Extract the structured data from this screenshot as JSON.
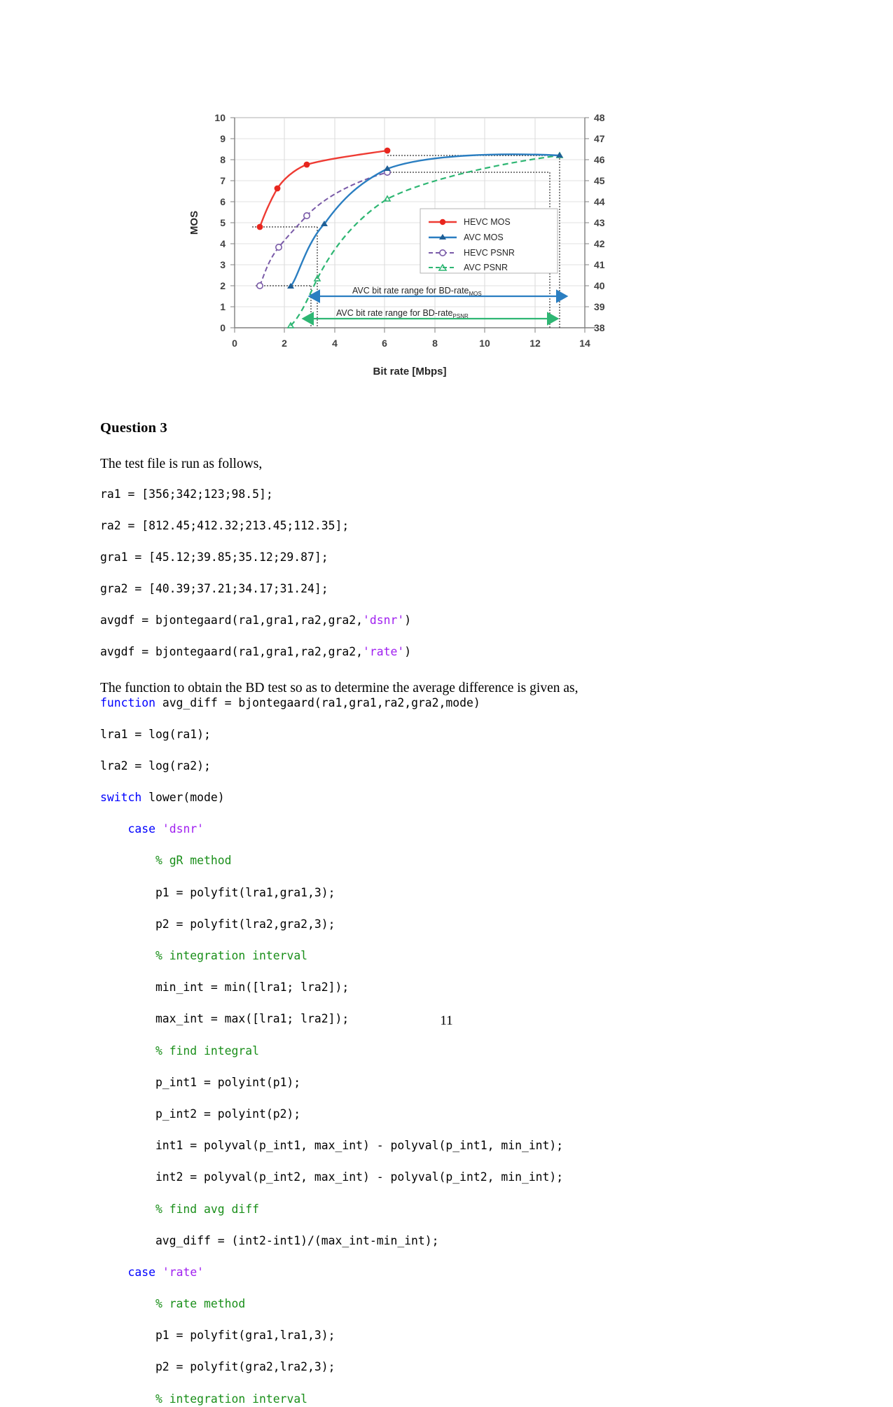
{
  "document": {
    "page_number": "11",
    "question_heading": "Question 3",
    "intro_paragraph": "The test file is run as follows,",
    "function_paragraph": "The function to obtain the BD test so as to determine the average difference is given as,"
  },
  "code_block_1": [
    [
      {
        "t": "ra1 = [356;342;123;98.5];",
        "c": "plain"
      }
    ],
    [
      {
        "t": "ra2 = [812.45;412.32;213.45;112.35];",
        "c": "plain"
      }
    ],
    [
      {
        "t": "gra1 = [45.12;39.85;35.12;29.87];",
        "c": "plain"
      }
    ],
    [
      {
        "t": "gra2 = [40.39;37.21;34.17;31.24];",
        "c": "plain"
      }
    ],
    [
      {
        "t": "avgdf = bjontegaard(ra1,gra1,ra2,gra2,",
        "c": "plain"
      },
      {
        "t": "'dsnr'",
        "c": "str"
      },
      {
        "t": ")",
        "c": "plain"
      }
    ],
    [
      {
        "t": "avgdf = bjontegaard(ra1,gra1,ra2,gra2,",
        "c": "plain"
      },
      {
        "t": "'rate'",
        "c": "str"
      },
      {
        "t": ")",
        "c": "plain"
      }
    ]
  ],
  "code_block_2": [
    [
      {
        "t": "function",
        "c": "kw"
      },
      {
        "t": " avg_diff = bjontegaard(ra1,gra1,ra2,gra2,mode)",
        "c": "plain"
      }
    ],
    [
      {
        "t": "lra1 = log(ra1);",
        "c": "plain"
      }
    ],
    [
      {
        "t": "lra2 = log(ra2);",
        "c": "plain"
      }
    ],
    [
      {
        "t": "switch",
        "c": "kw"
      },
      {
        "t": " lower(mode)",
        "c": "plain"
      }
    ],
    [
      {
        "t": "    ",
        "c": "plain"
      },
      {
        "t": "case",
        "c": "kw"
      },
      {
        "t": " ",
        "c": "plain"
      },
      {
        "t": "'dsnr'",
        "c": "str"
      }
    ],
    [
      {
        "t": "        ",
        "c": "plain"
      },
      {
        "t": "% gR method",
        "c": "cmt"
      }
    ],
    [
      {
        "t": "        p1 = polyfit(lra1,gra1,3);",
        "c": "plain"
      }
    ],
    [
      {
        "t": "        p2 = polyfit(lra2,gra2,3);",
        "c": "plain"
      }
    ],
    [
      {
        "t": "        ",
        "c": "plain"
      },
      {
        "t": "% integration interval",
        "c": "cmt"
      }
    ],
    [
      {
        "t": "        min_int = min([lra1; lra2]);",
        "c": "plain"
      }
    ],
    [
      {
        "t": "        max_int = max([lra1; lra2]);",
        "c": "plain"
      }
    ],
    [
      {
        "t": "        ",
        "c": "plain"
      },
      {
        "t": "% find integral",
        "c": "cmt"
      }
    ],
    [
      {
        "t": "        p_int1 = polyint(p1);",
        "c": "plain"
      }
    ],
    [
      {
        "t": "        p_int2 = polyint(p2);",
        "c": "plain"
      }
    ],
    [
      {
        "t": "        int1 = polyval(p_int1, max_int) - polyval(p_int1, min_int);",
        "c": "plain"
      }
    ],
    [
      {
        "t": "        int2 = polyval(p_int2, max_int) - polyval(p_int2, min_int);",
        "c": "plain"
      }
    ],
    [
      {
        "t": "        ",
        "c": "plain"
      },
      {
        "t": "% find avg diff",
        "c": "cmt"
      }
    ],
    [
      {
        "t": "        avg_diff = (int2-int1)/(max_int-min_int);",
        "c": "plain"
      }
    ],
    [
      {
        "t": "    ",
        "c": "plain"
      },
      {
        "t": "case",
        "c": "kw"
      },
      {
        "t": " ",
        "c": "plain"
      },
      {
        "t": "'rate'",
        "c": "str"
      }
    ],
    [
      {
        "t": "        ",
        "c": "plain"
      },
      {
        "t": "% rate method",
        "c": "cmt"
      }
    ],
    [
      {
        "t": "        p1 = polyfit(gra1,lra1,3);",
        "c": "plain"
      }
    ],
    [
      {
        "t": "        p2 = polyfit(gra2,lra2,3);",
        "c": "plain"
      }
    ],
    [
      {
        "t": "        ",
        "c": "plain"
      },
      {
        "t": "% integration interval",
        "c": "cmt"
      }
    ]
  ],
  "chart_data": {
    "type": "line",
    "title": "",
    "xlabel": "Bit rate [Mbps]",
    "ylabel": "MOS",
    "y2label": "",
    "xlim": [
      0,
      14
    ],
    "xticks": [
      0,
      2,
      4,
      6,
      8,
      10,
      12,
      14
    ],
    "ylim": [
      0,
      10
    ],
    "yticks": [
      0,
      1,
      2,
      3,
      4,
      5,
      6,
      7,
      8,
      9,
      10
    ],
    "y2lim": [
      38,
      48
    ],
    "y2ticks": [
      38,
      39,
      40,
      41,
      42,
      43,
      44,
      45,
      46,
      47,
      48
    ],
    "grid": true,
    "legend_position": "center-right",
    "series": [
      {
        "name": "HEVC MOS",
        "axis": "left",
        "color": "#ee3b33",
        "marker": "filled-circle",
        "dash": "solid",
        "points": [
          [
            1.0,
            4.8
          ],
          [
            1.7,
            6.7
          ],
          [
            2.8,
            7.9
          ],
          [
            6.1,
            8.45
          ]
        ]
      },
      {
        "name": "AVC MOS",
        "axis": "left",
        "color": "#2a7ec1",
        "marker": "filled-triangle",
        "dash": "solid",
        "points": [
          [
            2.25,
            1.95
          ],
          [
            3.55,
            5.3
          ],
          [
            6.15,
            7.55
          ],
          [
            13.0,
            8.2
          ]
        ]
      },
      {
        "name": "HEVC PSNR",
        "axis": "right",
        "color": "#7a5ba8",
        "marker": "open-circle",
        "dash": "dashed",
        "points": [
          [
            1.0,
            40.0
          ],
          [
            1.75,
            42.0
          ],
          [
            2.85,
            43.7
          ],
          [
            6.1,
            45.4
          ]
        ]
      },
      {
        "name": "AVC PSNR",
        "axis": "right",
        "color": "#2eb673",
        "marker": "open-triangle",
        "dash": "dashed",
        "points": [
          [
            2.25,
            38.1
          ],
          [
            3.3,
            41.1
          ],
          [
            6.1,
            43.5
          ],
          [
            13.0,
            45.4
          ]
        ]
      }
    ],
    "annotations": [
      {
        "id": "mos-range",
        "text": "AVC bit rate range for BD-rate",
        "subscript": "MOS",
        "color": "#2a7ec1",
        "x_from": 3.3,
        "x_to": 13.0,
        "y": 1.5
      },
      {
        "id": "psnr-range",
        "text": "AVC bit rate range for BD-rate",
        "subscript": "PSNR",
        "color": "#2eb673",
        "x_from": 3.05,
        "x_to": 12.6,
        "y": 0.45
      }
    ],
    "guide_lines": [
      {
        "type": "horizontal",
        "y": 4.8,
        "x_from": 0.7,
        "x_to": 3.3
      },
      {
        "type": "horizontal",
        "y": 2.0,
        "x_from": 0.85,
        "x_to": 3.05
      },
      {
        "type": "horizontal",
        "y": 8.2,
        "x_from": 6.1,
        "x_to": 13.0
      },
      {
        "type": "horizontal",
        "y": 7.4,
        "x_from": 6.1,
        "x_to": 12.6
      },
      {
        "type": "vertical",
        "x": 3.3
      },
      {
        "type": "vertical",
        "x": 3.05
      },
      {
        "type": "vertical",
        "x": 13.0
      },
      {
        "type": "vertical",
        "x": 12.6
      }
    ]
  }
}
